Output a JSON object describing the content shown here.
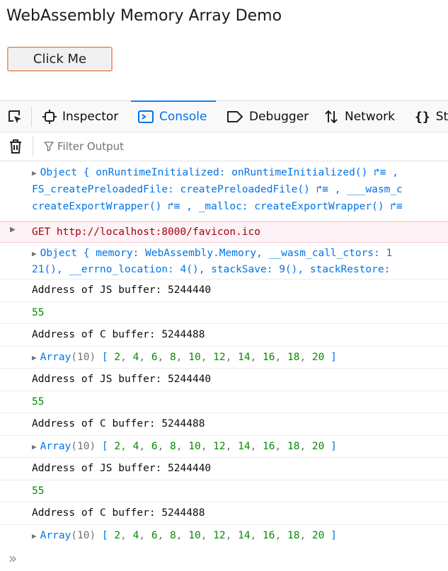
{
  "page": {
    "title": "WebAssembly Memory Array Demo",
    "button_label": "Click Me"
  },
  "devtools": {
    "tabs": [
      {
        "label": "Inspector",
        "icon": "inspector-icon"
      },
      {
        "label": "Console",
        "icon": "console-icon",
        "selected": true
      },
      {
        "label": "Debugger",
        "icon": "debugger-icon"
      },
      {
        "label": "Network",
        "icon": "network-icon"
      },
      {
        "label": "St",
        "icon": "style-editor-icon"
      }
    ],
    "filter_placeholder": "Filter Output",
    "accent_color": "#0a84ff"
  },
  "console": {
    "object1": {
      "line1": "Object { onRuntimeInitialized: onRuntimeInitialized() ↱≡ ,",
      "line2": "FS_createPreloadedFile: createPreloadedFile() ↱≡ , ___wasm_c",
      "line3": "createExportWrapper() ↱≡ , _malloc: createExportWrapper() ↱≡"
    },
    "error": {
      "text": "GET http://localhost:8000/favicon.ico"
    },
    "object2": {
      "line1": "Object { memory: WebAssembly.Memory, __wasm_call_ctors: 1",
      "line2": "21(), __errno_location: 4(), stackSave: 9(), stackRestore: "
    },
    "messages": [
      {
        "type": "text",
        "text": "Address of JS buffer: 5244440"
      },
      {
        "type": "number",
        "text": "55"
      },
      {
        "type": "text",
        "text": "Address of C buffer: 5244488"
      },
      {
        "type": "array",
        "name": "Array",
        "length": "(10)",
        "values": [
          "2",
          "4",
          "6",
          "8",
          "10",
          "12",
          "14",
          "16",
          "18",
          "20"
        ]
      },
      {
        "type": "text",
        "text": "Address of JS buffer: 5244440"
      },
      {
        "type": "number",
        "text": "55"
      },
      {
        "type": "text",
        "text": "Address of C buffer: 5244488"
      },
      {
        "type": "array",
        "name": "Array",
        "length": "(10)",
        "values": [
          "2",
          "4",
          "6",
          "8",
          "10",
          "12",
          "14",
          "16",
          "18",
          "20"
        ]
      },
      {
        "type": "text",
        "text": "Address of JS buffer: 5244440"
      },
      {
        "type": "number",
        "text": "55"
      },
      {
        "type": "text",
        "text": "Address of C buffer: 5244488"
      },
      {
        "type": "array",
        "name": "Array",
        "length": "(10)",
        "values": [
          "2",
          "4",
          "6",
          "8",
          "10",
          "12",
          "14",
          "16",
          "18",
          "20"
        ]
      }
    ],
    "prompt_icon": "»"
  }
}
